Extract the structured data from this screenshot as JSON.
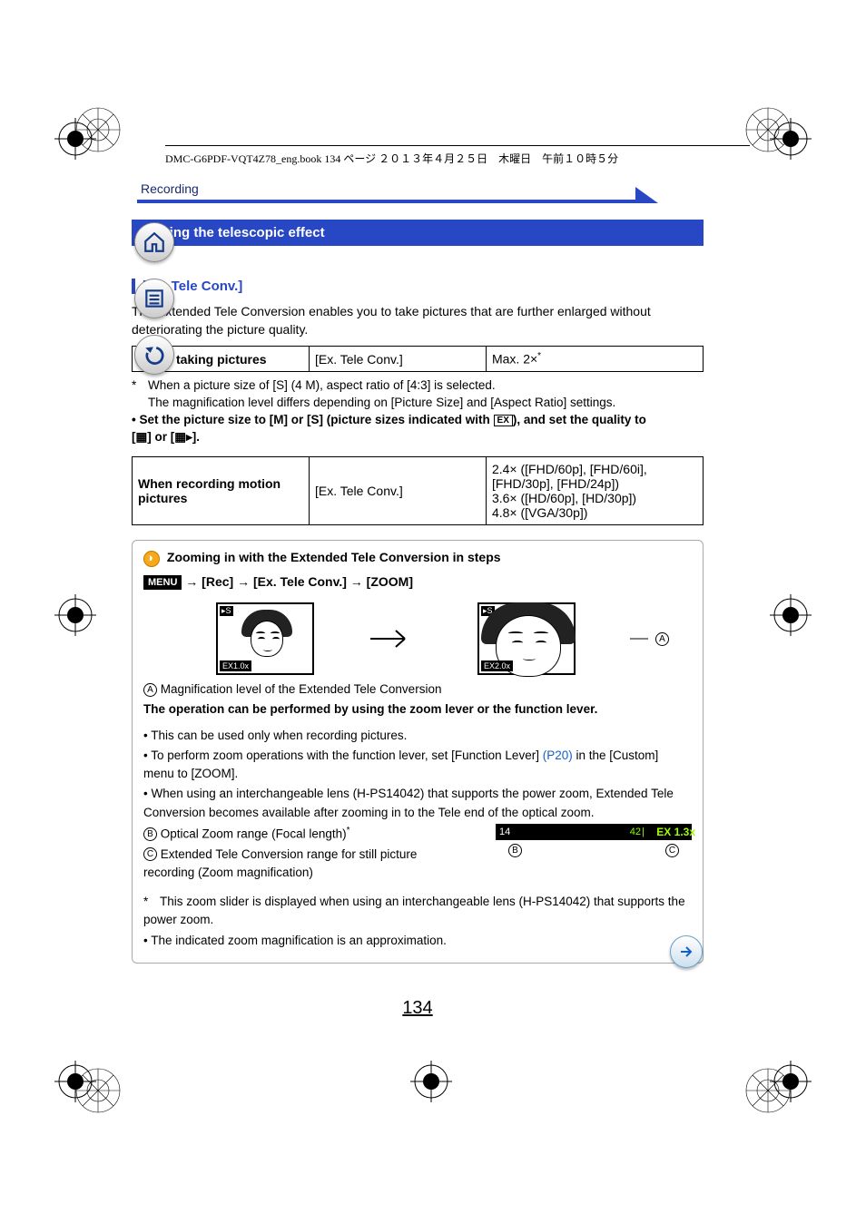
{
  "header_line": "DMC-G6PDF-VQT4Z78_eng.book  134 ページ  ２０１３年４月２５日　木曜日　午前１０時５分",
  "section_label": "Recording",
  "title_bar": "Raising the telescopic effect",
  "sub_head": "[Ex. Tele Conv.]",
  "intro": "The Extended Tele Conversion enables you to take pictures that are further enlarged without deteriorating the picture quality.",
  "table1": {
    "r1c1": "When taking pictures",
    "r1c2": "[Ex. Tele Conv.]",
    "r1c3_prefix": "Max. 2×",
    "r1c3_sup": "*"
  },
  "foot1_star": "*",
  "foot1_line1": "When a picture size of [S] (4 M), aspect ratio of [4:3] is selected.",
  "foot1_line2": "The magnification level differs depending on [Picture Size] and [Aspect Ratio] settings.",
  "note_bold_pre": "• Set the picture size to [M] or [S] (picture sizes indicated with ",
  "note_ex_icon": "EX",
  "note_bold_post": "), and set the quality to ",
  "note_icons_row": "[▦] or [▦▸].",
  "table2": {
    "r1c1": "When recording motion pictures",
    "r1c2": "[Ex. Tele Conv.]",
    "r1c3_l1": "2.4× ([FHD/60p], [FHD/60i], [FHD/30p], [FHD/24p])",
    "r1c3_l2": "3.6× ([HD/60p], [HD/30p])",
    "r1c3_l3": "4.8× ([VGA/30p])"
  },
  "tip_title": "Zooming in with the Extended Tele Conversion in steps",
  "menu_chip": "MENU",
  "tip_flow": "→   [Rec] → [Ex. Tele Conv.] → [ZOOM]",
  "sim1_corner": "▸S",
  "sim1_label": "EX1.0x",
  "sim2_corner": "▸S",
  "sim2_label": "EX2.0x",
  "callout_A": "A",
  "legend_A": "Magnification level of the Extended Tele Conversion",
  "op_bold": "The operation can be performed by using the zoom lever or the function lever.",
  "bul1": "• This can be used only when recording pictures.",
  "bul2a": "• To perform zoom operations with the function lever, set [Function Lever] ",
  "bul2_link": "(P20)",
  "bul2b": " in the [Custom] menu to [ZOOM].",
  "bul3": "• When using an interchangeable lens (H-PS14042) that supports the power zoom, Extended Tele Conversion becomes available after zooming in to the Tele end of the optical zoom.",
  "legB_letter": "B",
  "legB_text": "Optical Zoom range (Focal length)",
  "legB_sup": "*",
  "legC_letter": "C",
  "legC_text": "Extended Tele Conversion range for still picture recording (Zoom magnification)",
  "zoom_left": "14",
  "zoom_tick": "|",
  "zoom_right": "42",
  "zoom_ex": "EX 1.3x",
  "zoom_lb_B": "B",
  "zoom_lb_C": "C",
  "foot2_star": "*",
  "foot2": "This zoom slider is displayed when using an interchangeable lens (H-PS14042) that supports the power zoom.",
  "bul4": "• The indicated zoom magnification is an approximation.",
  "page_number": "134"
}
